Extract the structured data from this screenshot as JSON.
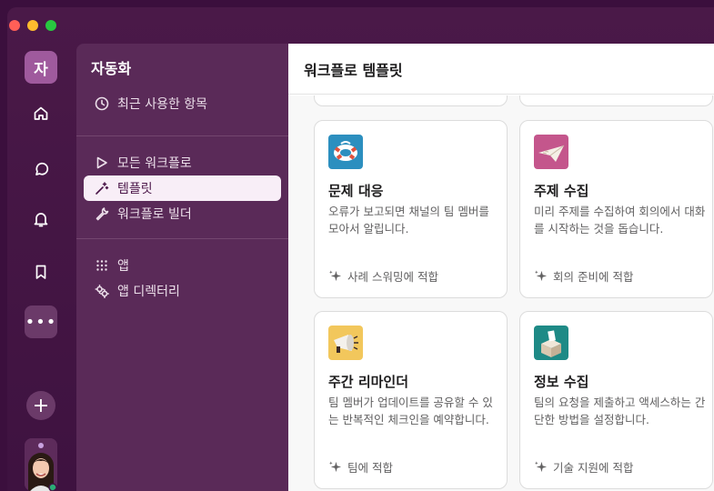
{
  "workspace": {
    "initial": "자"
  },
  "panel": {
    "title": "자동화",
    "recent": "최근 사용한 항목",
    "all_workflows": "모든 워크플로",
    "templates": "템플릿",
    "builder": "워크플로 빌더",
    "apps": "앱",
    "app_directory": "앱 디렉터리"
  },
  "main": {
    "title": "워크플로 템플릿",
    "cards": [
      {
        "title": "문제 대응",
        "desc": "오류가 보고되면 채널의 팀 멤버를 모아서 알립니다.",
        "fit": "사례 스워밍에 적합"
      },
      {
        "title": "주제 수집",
        "desc": "미리 주제를 수집하여 회의에서 대화를 시작하는 것을 돕습니다.",
        "fit": "회의 준비에 적합"
      },
      {
        "title": "주간 리마인더",
        "desc": "팀 멤버가 업데이트를 공유할 수 있는 반복적인 체크인을 예약합니다.",
        "fit": "팀에 적합"
      },
      {
        "title": "정보 수집",
        "desc": "팀의 요청을 제출하고 액세스하는 간단한 방법을 설정합니다.",
        "fit": "기술 지원에 적합"
      }
    ]
  },
  "icons": {
    "rail": [
      "home-icon",
      "dms-icon",
      "activity-bell-icon",
      "bookmark-icon"
    ],
    "cards": [
      "lifebuoy-icon",
      "paper-plane-icon",
      "megaphone-icon",
      "ballot-box-icon"
    ]
  },
  "colors": {
    "sidebar": "#3e1240",
    "panel": "#5a2a58",
    "active_bg": "#f8eef7",
    "workspace_badge": "#9f5a9d"
  }
}
